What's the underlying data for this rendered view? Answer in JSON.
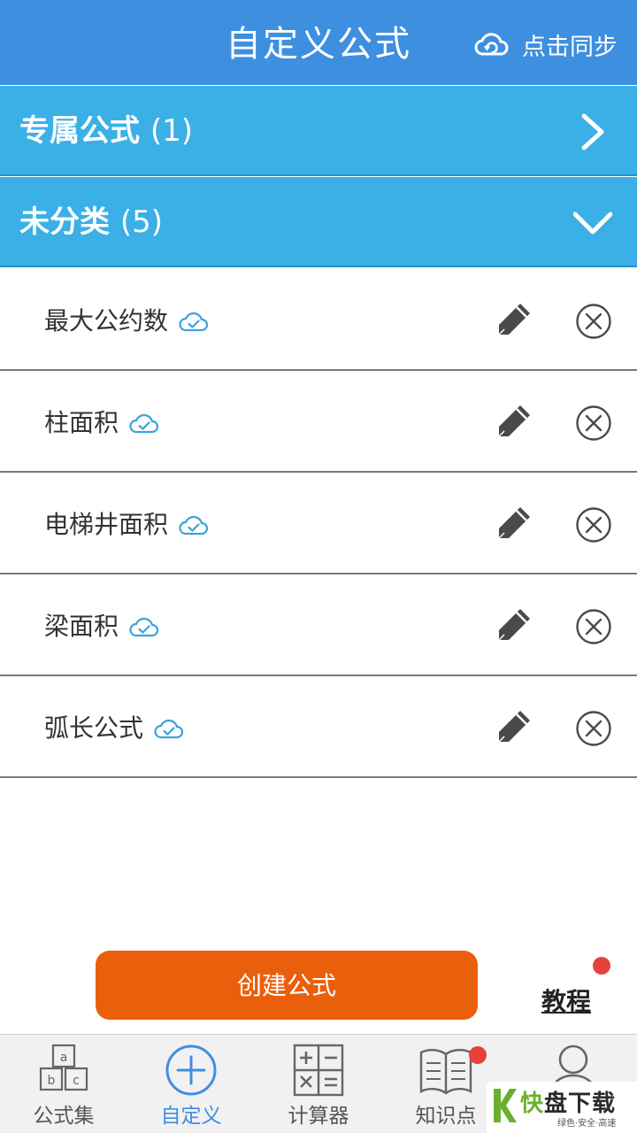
{
  "header": {
    "title": "自定义公式",
    "sync_label": "点击同步"
  },
  "groups": [
    {
      "name": "专属公式",
      "count": "(1)",
      "state": "collapsed"
    },
    {
      "name": "未分类",
      "count": "(5)",
      "state": "expanded"
    }
  ],
  "formulas": [
    {
      "name": "最大公约数"
    },
    {
      "name": "柱面积"
    },
    {
      "name": "电梯井面积"
    },
    {
      "name": "梁面积"
    },
    {
      "name": "弧长公式"
    }
  ],
  "actions": {
    "create_label": "创建公式",
    "tutorial_label": "教程"
  },
  "tabbar": {
    "items": [
      {
        "label": "公式集",
        "icon": "abc-blocks-icon"
      },
      {
        "label": "自定义",
        "icon": "plus-circle-icon",
        "active": true
      },
      {
        "label": "计算器",
        "icon": "calculator-icon"
      },
      {
        "label": "知识点",
        "icon": "book-icon"
      },
      {
        "label": "",
        "icon": "user-icon"
      }
    ]
  },
  "watermark": {
    "brand_k": "快",
    "brand": "盘下载",
    "tagline": "绿色·安全·高速"
  },
  "colors": {
    "header": "#3e8fe0",
    "group": "#3bb0e6",
    "accent_orange": "#ea5f0c",
    "badge_red": "#e8413b",
    "cloud": "#3ba3dc"
  }
}
